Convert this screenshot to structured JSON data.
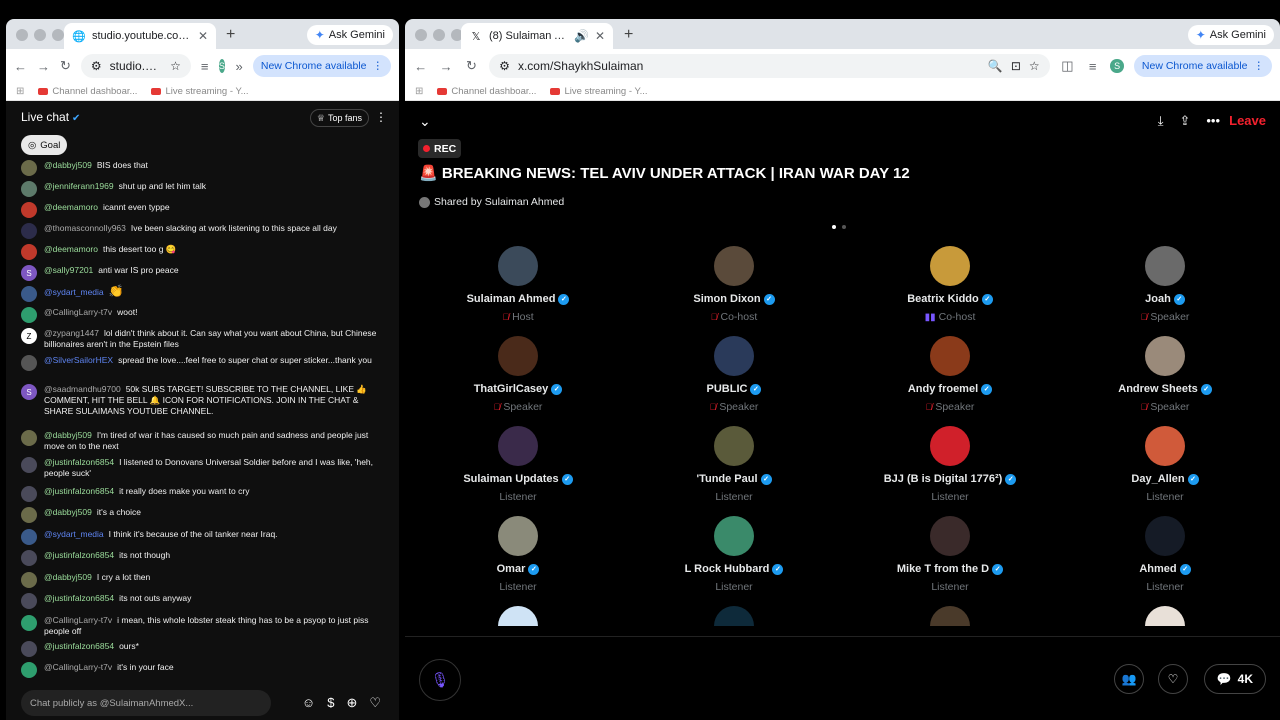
{
  "left_browser": {
    "tab_title": "studio.youtube.com/live_chat",
    "url": "studio.you...",
    "ask_gemini": "Ask Gemini",
    "new_chrome": "New Chrome available",
    "profile_initial": "S",
    "bookmarks": [
      "Channel dashboar...",
      "Live streaming - Y..."
    ]
  },
  "right_browser": {
    "tab_title": "(8) Sulaiman Ahmed (@S",
    "url": "x.com/ShaykhSulaiman",
    "ask_gemini": "Ask Gemini",
    "new_chrome": "New Chrome available",
    "profile_initial": "S",
    "bookmarks": [
      "Channel dashboar...",
      "Live streaming - Y..."
    ]
  },
  "chat": {
    "title": "Live chat",
    "top_fans": "Top fans",
    "goal": "Goal",
    "input_placeholder": "Chat publicly as @SulaimanAhmedX...",
    "messages": [
      {
        "author": "@dabbyj509",
        "text": "BIS does that"
      },
      {
        "author": "@jenniferann1969",
        "text": "shut up and let him talk"
      },
      {
        "author": "@deemamoro",
        "text": "icannt even typpe"
      },
      {
        "author": "@thomasconnolly963",
        "text": "Ive been slacking at work listening to this space all day"
      },
      {
        "author": "@deemamoro",
        "text": "this desert too g 😋"
      },
      {
        "author": "@sally97201",
        "text": "anti war IS pro peace"
      },
      {
        "author": "@sydart_media",
        "text": "👏"
      },
      {
        "author": "@CallingLarry-t7v",
        "text": "woot!"
      },
      {
        "author": "@zypang1447",
        "text": "lol didn't think about it. Can say what you want about China, but Chinese billionaires aren't in the Epstein files"
      },
      {
        "author": "@SilverSailorHEX",
        "text": "spread the love....feel free to super chat or super sticker...thank you"
      },
      {
        "author": "@saadmandhu9700",
        "text": "50k SUBS TARGET! SUBSCRIBE TO THE CHANNEL, LIKE 👍 COMMENT, HIT THE BELL 🔔 ICON FOR NOTIFICATIONS. JOIN IN THE CHAT & SHARE SULAIMANS YOUTUBE CHANNEL."
      },
      {
        "author": "@dabbyj509",
        "text": "I'm tired of war it has caused so much pain and sadness and people just move on to the next"
      },
      {
        "author": "@justinfalzon6854",
        "text": "I listened to Donovans Universal Soldier before and I was like, 'heh, people suck'"
      },
      {
        "author": "@justinfalzon6854",
        "text": "it really does make you want to cry"
      },
      {
        "author": "@dabbyj509",
        "text": "it's a choice"
      },
      {
        "author": "@sydart_media",
        "text": "I think it's because of the oil tanker near Iraq."
      },
      {
        "author": "@justinfalzon6854",
        "text": "its not though"
      },
      {
        "author": "@dabbyj509",
        "text": "I cry a lot then"
      },
      {
        "author": "@justinfalzon6854",
        "text": "its not outs anyway"
      },
      {
        "author": "@CallingLarry-t7v",
        "text": "i mean, this whole lobster steak thing has to be a psyop to just piss people off"
      },
      {
        "author": "@justinfalzon6854",
        "text": "ours*"
      },
      {
        "author": "@CallingLarry-t7v",
        "text": "it's in your face"
      }
    ]
  },
  "space": {
    "rec": "REC",
    "leave": "Leave",
    "title": "BREAKING NEWS: TEL AVIV UNDER ATTACK | IRAN WAR DAY 12",
    "shared_by": "Shared by Sulaiman Ahmed",
    "listener_count": "4K",
    "participants": [
      {
        "name": "Sulaiman Ahmed",
        "role": "Host"
      },
      {
        "name": "Simon Dixon",
        "role": "Co-host"
      },
      {
        "name": "Beatrix Kiddo",
        "role": "Co-host"
      },
      {
        "name": "Joah",
        "role": "Speaker"
      },
      {
        "name": "ThatGirlCasey",
        "role": "Speaker"
      },
      {
        "name": "PUBLIC",
        "role": "Speaker"
      },
      {
        "name": "Andy froemel",
        "role": "Speaker"
      },
      {
        "name": "Andrew Sheets",
        "role": "Speaker"
      },
      {
        "name": "Sulaiman Updates",
        "role": "Listener"
      },
      {
        "name": "'Tunde Paul",
        "role": "Listener"
      },
      {
        "name": "BJJ (B is Digital 1776²)",
        "role": "Listener"
      },
      {
        "name": "Day_Allen",
        "role": "Listener"
      },
      {
        "name": "Omar",
        "role": "Listener"
      },
      {
        "name": "L Rock Hubbard",
        "role": "Listener"
      },
      {
        "name": "Mike T from the D",
        "role": "Listener"
      },
      {
        "name": "Ahmed",
        "role": "Listener"
      }
    ]
  }
}
